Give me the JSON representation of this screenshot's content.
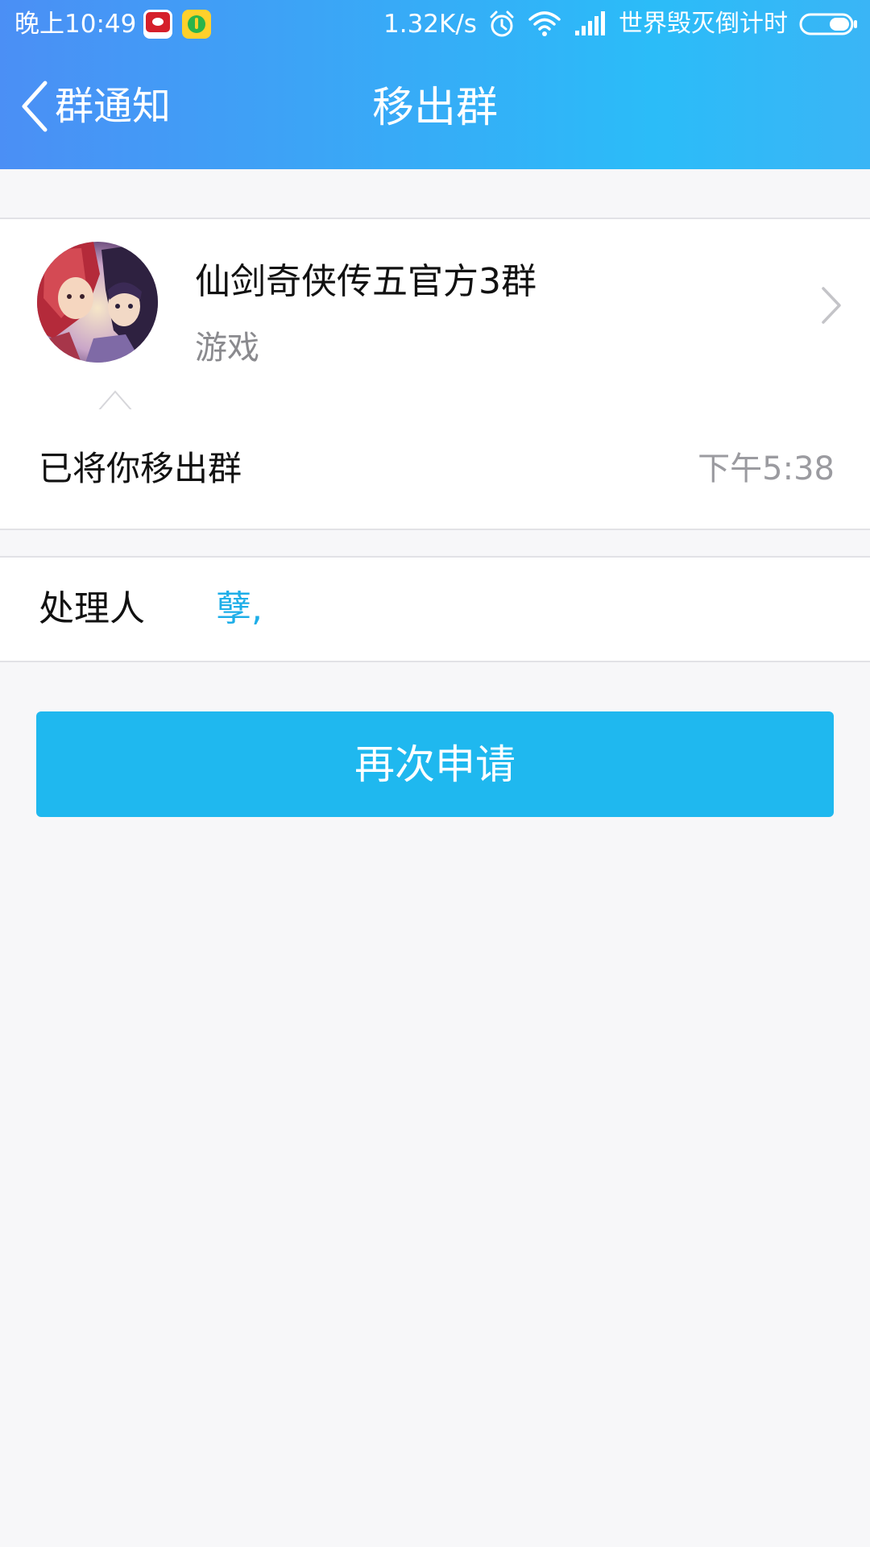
{
  "status_bar": {
    "time": "晚上10:49",
    "net_speed": "1.32K/s",
    "carrier": "世界毁灭倒计时",
    "icons": [
      "app-red-icon",
      "music-icon",
      "alarm-icon",
      "wifi-icon",
      "signal-icon",
      "battery-icon"
    ]
  },
  "nav": {
    "back_label": "群通知",
    "title": "移出群"
  },
  "group": {
    "name": "仙剑奇侠传五官方3群",
    "category": "游戏"
  },
  "notice": {
    "text": "已将你移出群",
    "time": "下午5:38"
  },
  "handler": {
    "label": "处理人",
    "name": "孽,"
  },
  "actions": {
    "reapply_label": "再次申请"
  },
  "colors": {
    "header_start": "#4b8ff5",
    "header_end": "#2bbcf8",
    "accent_button": "#1fb8ef",
    "link": "#1eaee8",
    "background": "#f7f7f9"
  }
}
